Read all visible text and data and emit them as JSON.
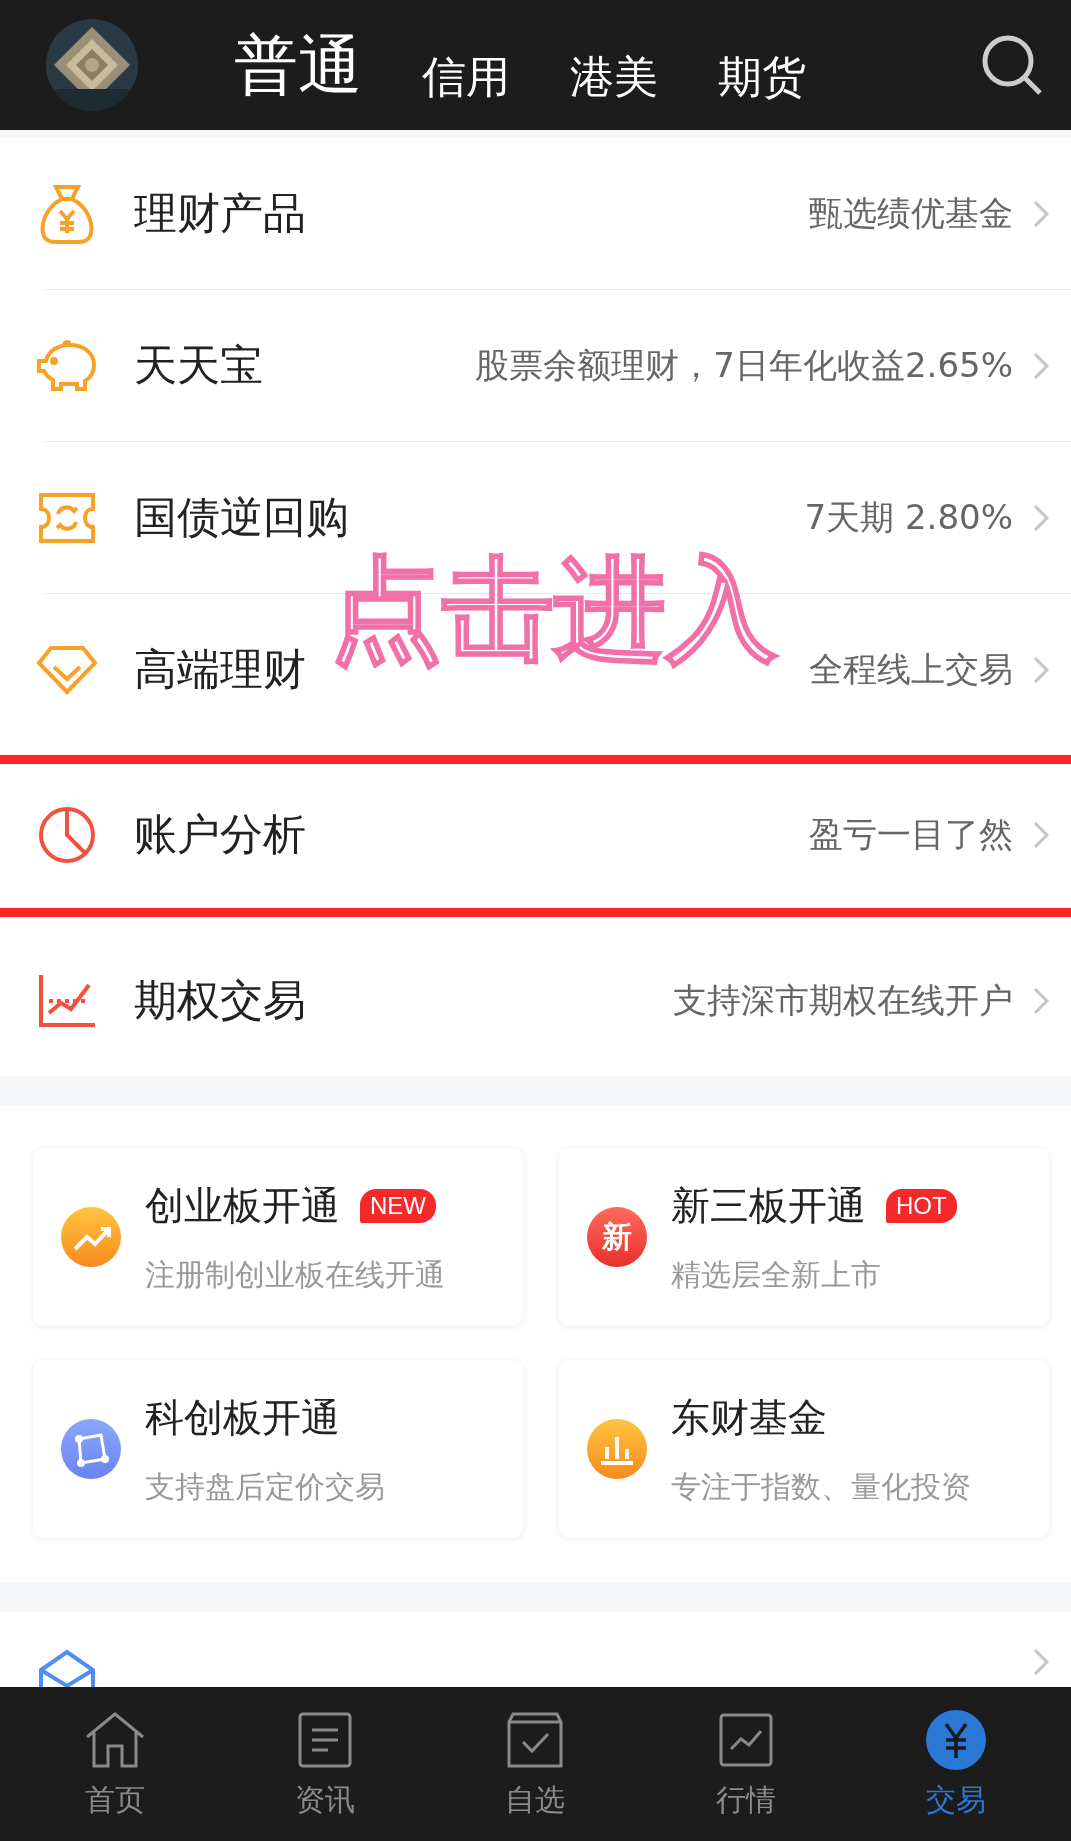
{
  "top_tabs": [
    {
      "label": "普通",
      "selected": true
    },
    {
      "label": "信用",
      "selected": false
    },
    {
      "label": "港美",
      "selected": false
    },
    {
      "label": "期货",
      "selected": false
    }
  ],
  "menu_rows": [
    {
      "kind": "bag",
      "title": "理财产品",
      "subtitle": "甄选绩优基金",
      "highlighted": false
    },
    {
      "kind": "piggy",
      "title": "天天宝",
      "subtitle": "股票余额理财，7日年化收益2.65%",
      "highlighted": false
    },
    {
      "kind": "ticket",
      "title": "国债逆回购",
      "subtitle": "7天期 2.80%",
      "highlighted": false
    },
    {
      "kind": "diamond",
      "title": "高端理财",
      "subtitle": "全程线上交易",
      "highlighted": false
    },
    {
      "kind": "pie",
      "title": "账户分析",
      "subtitle": "盈亏一目了然",
      "highlighted": true
    },
    {
      "kind": "chart",
      "title": "期权交易",
      "subtitle": "支持深市期权在线开户",
      "highlighted": false
    }
  ],
  "annotation": {
    "text": "点击进入"
  },
  "cards": [
    {
      "kind": "trend",
      "title": "创业板开通",
      "badge": "NEW",
      "subtitle": "注册制创业板在线开通"
    },
    {
      "kind": "glyph",
      "icon_text": "新",
      "title": "新三板开通",
      "badge": "HOT",
      "subtitle": "精选层全新上市"
    },
    {
      "kind": "nodes",
      "title": "科创板开通",
      "subtitle": "支持盘后定价交易"
    },
    {
      "kind": "bars",
      "title": "东财基金",
      "subtitle": "专注于指数、量化投资"
    }
  ],
  "bottom_nav": [
    {
      "kind": "home",
      "label": "首页",
      "selected": false
    },
    {
      "kind": "doc",
      "label": "资讯",
      "selected": false
    },
    {
      "kind": "check",
      "label": "自选",
      "selected": false
    },
    {
      "kind": "line",
      "label": "行情",
      "selected": false
    },
    {
      "kind": "yen",
      "label": "交易",
      "selected": true
    }
  ]
}
